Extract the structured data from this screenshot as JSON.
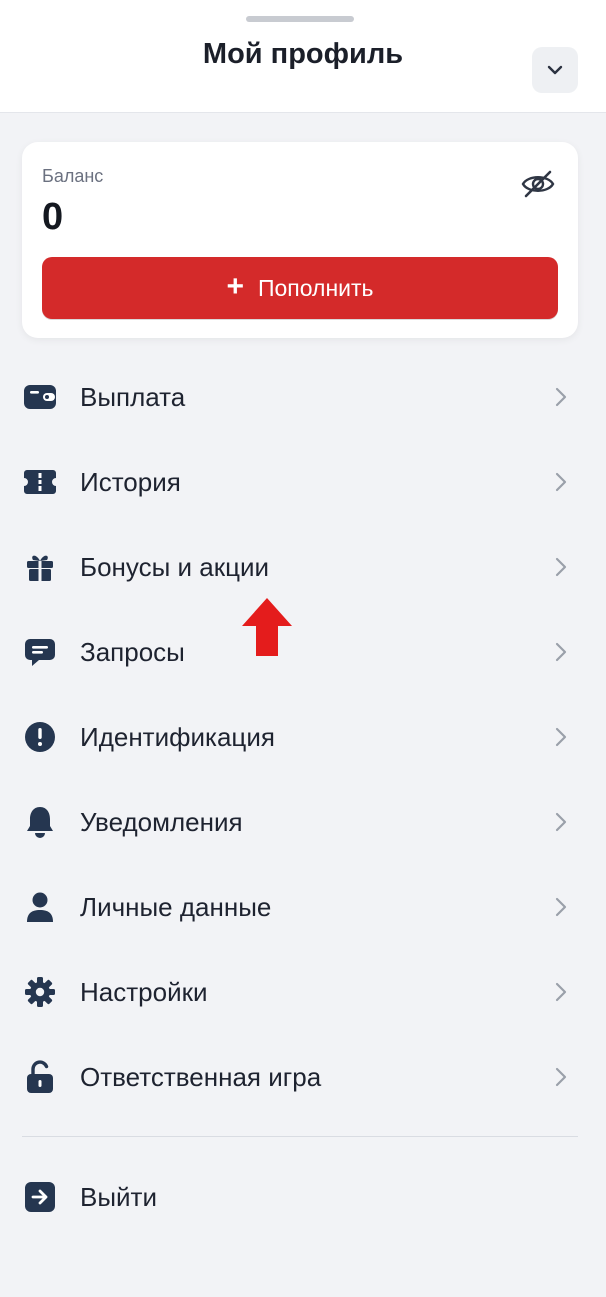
{
  "header": {
    "title": "Мой профиль",
    "collapse_icon": "chevron-down-icon"
  },
  "balance": {
    "label": "Баланс",
    "value": "0",
    "visibility_icon": "eye-off-icon",
    "topup_label": "Пополнить",
    "topup_icon": "plus-icon",
    "accent_color": "#d42a2a"
  },
  "menu": {
    "items": [
      {
        "label": "Выплата",
        "icon": "wallet-icon"
      },
      {
        "label": "История",
        "icon": "ticket-icon"
      },
      {
        "label": "Бонусы и акции",
        "icon": "gift-icon"
      },
      {
        "label": "Запросы",
        "icon": "chat-icon"
      },
      {
        "label": "Идентификация",
        "icon": "alert-icon"
      },
      {
        "label": "Уведомления",
        "icon": "bell-icon"
      },
      {
        "label": "Личные данные",
        "icon": "user-icon"
      },
      {
        "label": "Настройки",
        "icon": "gear-icon"
      },
      {
        "label": "Ответственная игра",
        "icon": "lock-icon"
      }
    ]
  },
  "logout": {
    "label": "Выйти",
    "icon": "logout-icon"
  },
  "colors": {
    "icon": "#253650",
    "background": "#f2f3f6",
    "annotation_arrow": "#e41c1c"
  }
}
